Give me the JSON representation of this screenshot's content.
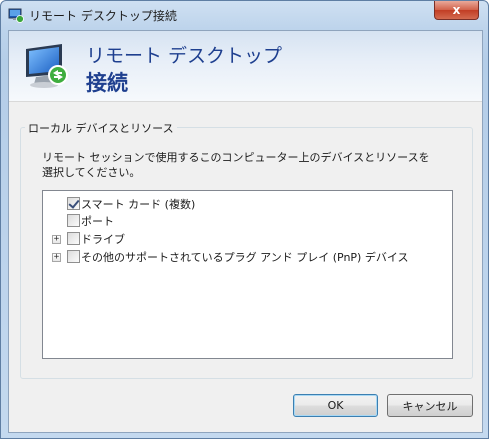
{
  "window": {
    "title": "リモート デスクトップ接続",
    "close_label": "x"
  },
  "header": {
    "line1": "リモート デスクトップ",
    "line2": "接続"
  },
  "group": {
    "legend": "ローカル デバイスとリソース",
    "description": "リモート セッションで使用するこのコンピューター上のデバイスとリソースを選択してください。"
  },
  "tree": {
    "items": [
      {
        "label": "スマート カード (複数)",
        "checked": true,
        "expandable": false
      },
      {
        "label": "ポート",
        "checked": false,
        "expandable": false
      },
      {
        "label": "ドライブ",
        "checked": false,
        "expandable": true,
        "expander": "+"
      },
      {
        "label": "その他のサポートされているプラグ アンド プレイ (PnP) デバイス",
        "checked": false,
        "expandable": true,
        "expander": "+"
      }
    ]
  },
  "buttons": {
    "ok": "OK",
    "cancel": "キャンセル"
  },
  "colors": {
    "header_text": "#1e3f8f",
    "close": "#c13d24"
  }
}
